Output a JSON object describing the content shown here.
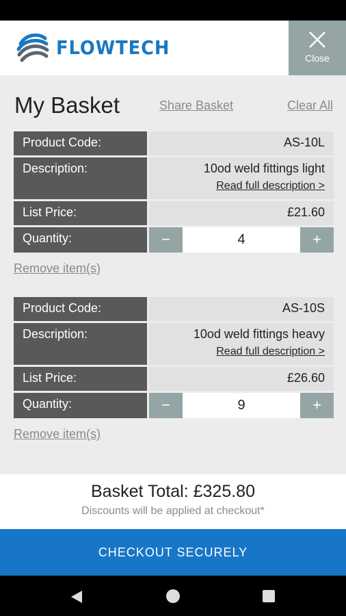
{
  "header": {
    "logo_text": "FLOWTECH",
    "close_label": "Close"
  },
  "basket": {
    "title": "My Basket",
    "share_label": "Share Basket",
    "clear_label": "Clear All",
    "labels": {
      "code": "Product Code:",
      "description": "Description:",
      "price": "List Price:",
      "quantity": "Quantity:"
    },
    "read_more_label": "Read full description >",
    "remove_label": "Remove item(s)",
    "decrement_symbol": "−",
    "increment_symbol": "+",
    "items": [
      {
        "code": "AS-10L",
        "description": "10od weld fittings light",
        "price": "£21.60",
        "quantity": "4"
      },
      {
        "code": "AS-10S",
        "description": "10od weld fittings heavy",
        "price": "£26.60",
        "quantity": "9"
      }
    ]
  },
  "summary": {
    "total_text": "Basket Total: £325.80",
    "discount_note": "Discounts will be applied at checkout*"
  },
  "checkout_label": "CHECKOUT SECURELY",
  "colors": {
    "brand": "#1a78c2",
    "checkout": "#1776c7",
    "label_bg": "#595959",
    "button_bg": "#95a5a6"
  },
  "icons": {
    "close": "close-icon",
    "back": "back-triangle-icon",
    "home": "home-circle-icon",
    "recent": "recent-square-icon"
  }
}
